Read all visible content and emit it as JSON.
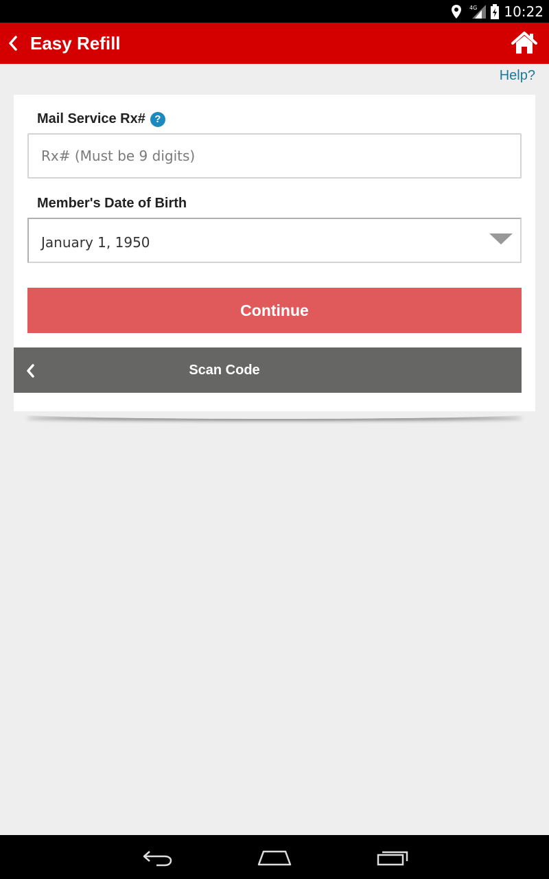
{
  "status_bar": {
    "time": "10:22",
    "network": "4G"
  },
  "header": {
    "title": "Easy Refill",
    "back_icon": "chevron-left-icon",
    "home_icon": "home-icon"
  },
  "help_link": "Help?",
  "form": {
    "rx_label": "Mail Service Rx#",
    "rx_help_icon": "?",
    "rx_placeholder": "Rx# (Must be 9 digits)",
    "rx_value": "",
    "dob_label": "Member's Date of Birth",
    "dob_value": "January 1, 1950",
    "continue_label": "Continue",
    "scan_label": "Scan Code"
  },
  "colors": {
    "app_bar": "#d40000",
    "continue_button": "#e05a5c",
    "scan_button": "#666765",
    "help_icon": "#1b8abf",
    "help_link": "#1a7a9c"
  },
  "nav": {
    "back_icon": "back-icon",
    "home_icon": "home-outline-icon",
    "recents_icon": "recents-icon"
  }
}
